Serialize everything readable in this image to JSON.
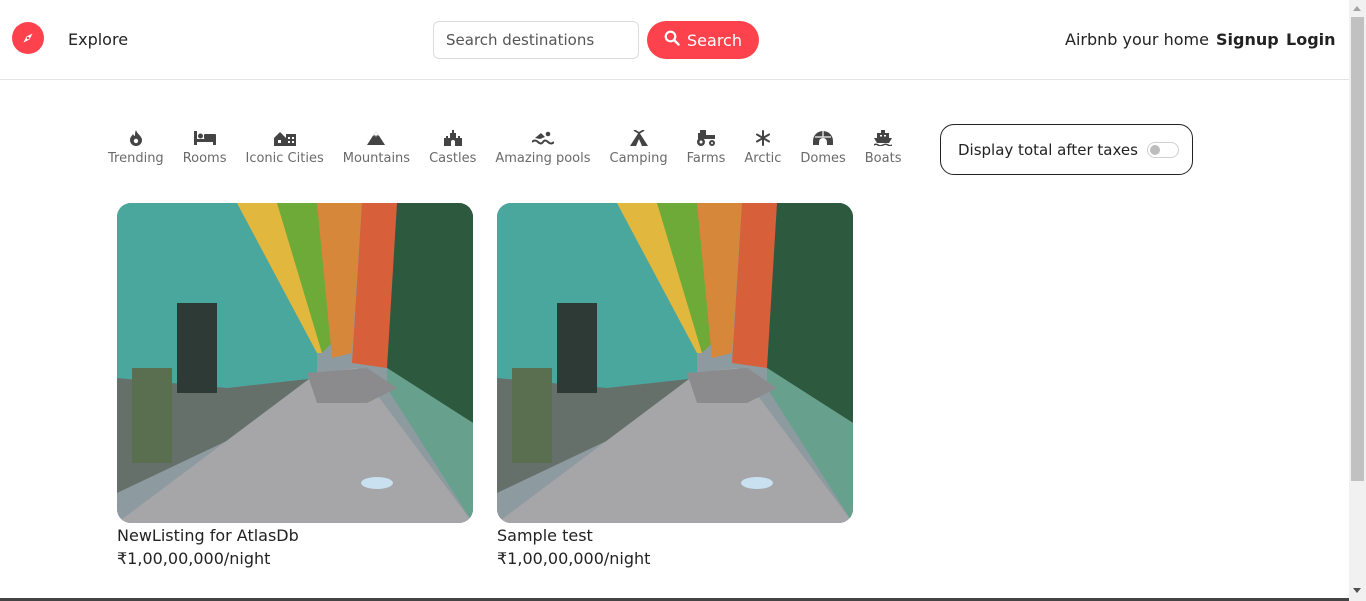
{
  "navbar": {
    "explore": "Explore",
    "search": {
      "placeholder": "Search destinations",
      "value": "",
      "button_label": "Search"
    },
    "host_link": "Airbnb your home",
    "signup": "Signup",
    "login": "Login"
  },
  "filters": [
    {
      "label": "Trending",
      "icon": "fire-icon"
    },
    {
      "label": "Rooms",
      "icon": "bed-icon"
    },
    {
      "label": "Iconic Cities",
      "icon": "city-icon"
    },
    {
      "label": "Mountains",
      "icon": "mountain-icon"
    },
    {
      "label": "Castles",
      "icon": "castle-icon"
    },
    {
      "label": "Amazing pools",
      "icon": "swimmer-icon"
    },
    {
      "label": "Camping",
      "icon": "tent-icon"
    },
    {
      "label": "Farms",
      "icon": "tractor-icon"
    },
    {
      "label": "Arctic",
      "icon": "snowflake-icon"
    },
    {
      "label": "Domes",
      "icon": "igloo-icon"
    },
    {
      "label": "Boats",
      "icon": "ship-icon"
    }
  ],
  "tax_toggle": {
    "label": "Display total after taxes",
    "enabled": false
  },
  "listings": [
    {
      "title": "NewListing for AtlasDb",
      "price": "₹1,00,00,000/night"
    },
    {
      "title": "Sample test",
      "price": "₹1,00,00,000/night"
    }
  ],
  "colors": {
    "brand": "#fe424d",
    "text": "#222222",
    "muted": "#6a6a6a"
  }
}
